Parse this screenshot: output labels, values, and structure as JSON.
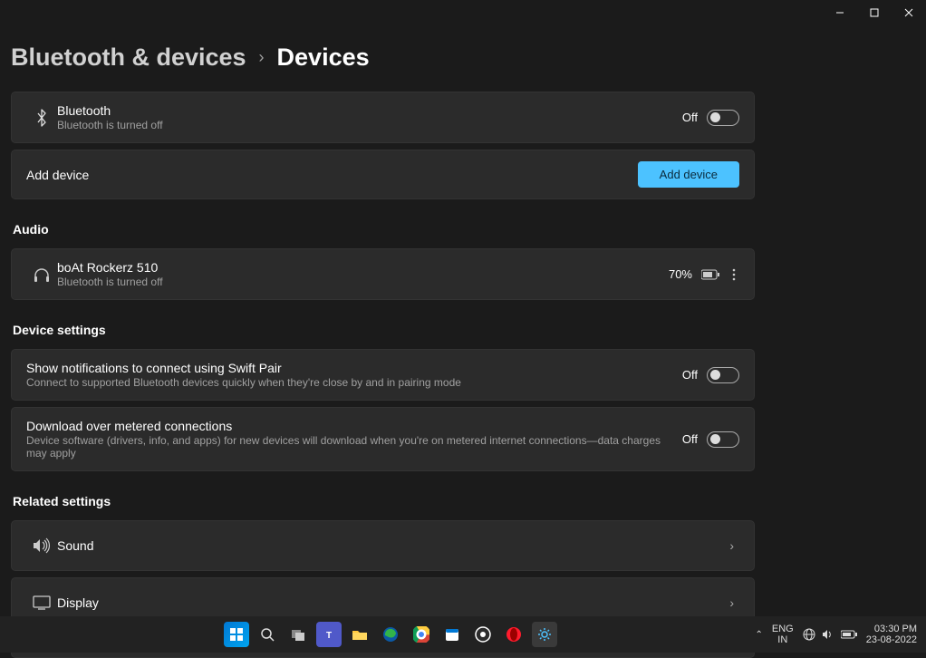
{
  "breadcrumb": {
    "parent": "Bluetooth & devices",
    "current": "Devices"
  },
  "bluetooth": {
    "title": "Bluetooth",
    "sub": "Bluetooth is turned off",
    "state": "Off"
  },
  "add_device": {
    "label": "Add device",
    "button": "Add device"
  },
  "sections": {
    "audio": "Audio",
    "device_settings": "Device settings",
    "related": "Related settings"
  },
  "audio_device": {
    "name": "boAt Rockerz 510",
    "sub": "Bluetooth is turned off",
    "battery": "70%"
  },
  "swift_pair": {
    "title": "Show notifications to connect using Swift Pair",
    "sub": "Connect to supported Bluetooth devices quickly when they're close by and in pairing mode",
    "state": "Off"
  },
  "metered": {
    "title": "Download over metered connections",
    "sub": "Device software (drivers, info, and apps) for new devices will download when you're on metered internet connections—data charges may apply",
    "state": "Off"
  },
  "related_items": {
    "sound": "Sound",
    "display": "Display"
  },
  "taskbar": {
    "lang1": "ENG",
    "lang2": "IN",
    "time": "03:30 PM",
    "date": "23-08-2022"
  }
}
